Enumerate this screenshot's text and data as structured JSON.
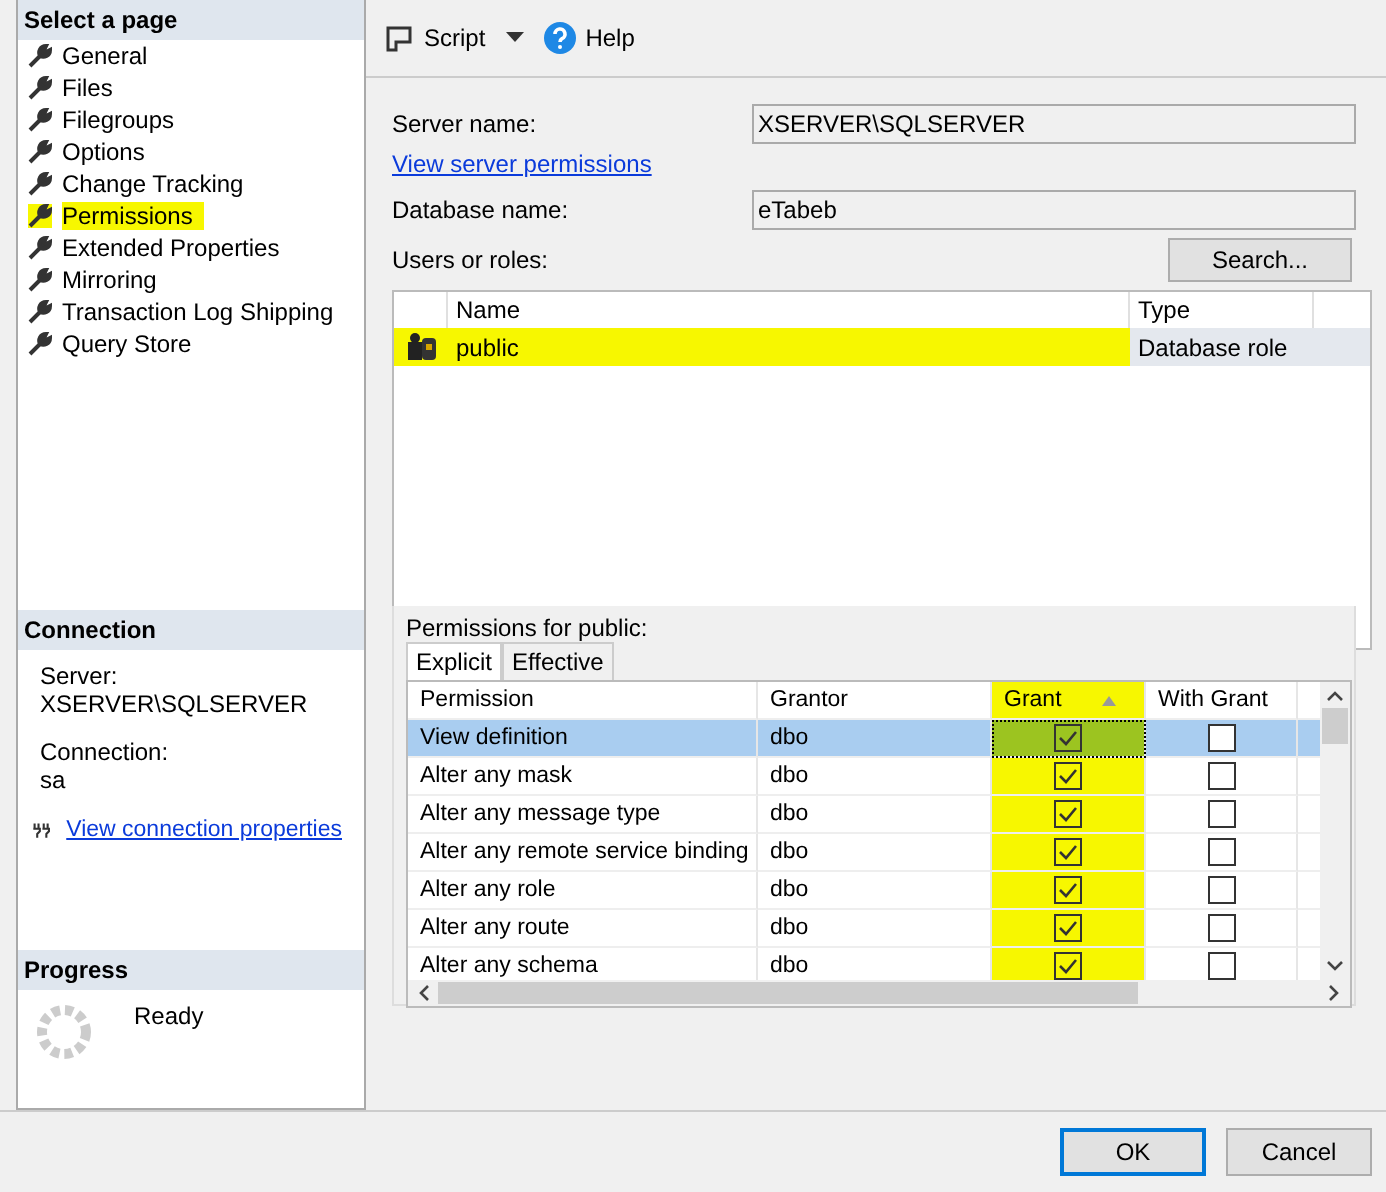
{
  "sidebar": {
    "title": "Select a page",
    "items": [
      {
        "label": "General",
        "selected": false,
        "highlighted": false
      },
      {
        "label": "Files",
        "selected": false,
        "highlighted": false
      },
      {
        "label": "Filegroups",
        "selected": false,
        "highlighted": false
      },
      {
        "label": "Options",
        "selected": false,
        "highlighted": false
      },
      {
        "label": "Change Tracking",
        "selected": false,
        "highlighted": false
      },
      {
        "label": "Permissions",
        "selected": true,
        "highlighted": true
      },
      {
        "label": "Extended Properties",
        "selected": false,
        "highlighted": false
      },
      {
        "label": "Mirroring",
        "selected": false,
        "highlighted": false
      },
      {
        "label": "Transaction Log Shipping",
        "selected": false,
        "highlighted": false
      },
      {
        "label": "Query Store",
        "selected": false,
        "highlighted": false
      }
    ]
  },
  "connection": {
    "title": "Connection",
    "server_label": "Server:",
    "server": "XSERVER\\SQLSERVER",
    "connection_label": "Connection:",
    "connection": "sa",
    "link": "View connection properties"
  },
  "progress": {
    "title": "Progress",
    "status": "Ready"
  },
  "toolbar": {
    "script": "Script",
    "help": "Help"
  },
  "form": {
    "server_label": "Server name:",
    "server": "XSERVER\\SQLSERVER",
    "server_permissions_link": "View server permissions",
    "database_label": "Database name:",
    "database": "eTabeb",
    "users_label": "Users or roles:",
    "search_button": "Search..."
  },
  "users": {
    "columns": [
      "Name",
      "Type"
    ],
    "rows": [
      {
        "name": "public",
        "type": "Database role",
        "selected": true,
        "highlighted": true
      }
    ]
  },
  "permissions": {
    "title": "Permissions for public:",
    "tabs": [
      {
        "label": "Explicit",
        "selected": true
      },
      {
        "label": "Effective",
        "selected": false
      }
    ],
    "columns": [
      {
        "label": "Permission"
      },
      {
        "label": "Grantor"
      },
      {
        "label": "Grant",
        "sorted": true,
        "highlighted": true
      },
      {
        "label": "With Grant"
      }
    ],
    "rows": [
      {
        "permission": "View definition",
        "grantor": "dbo",
        "grant": true,
        "with_grant": false,
        "selected": true
      },
      {
        "permission": "Alter any mask",
        "grantor": "dbo",
        "grant": true,
        "with_grant": false,
        "selected": false
      },
      {
        "permission": "Alter any message type",
        "grantor": "dbo",
        "grant": true,
        "with_grant": false,
        "selected": false
      },
      {
        "permission": "Alter any remote service binding",
        "grantor": "dbo",
        "grant": true,
        "with_grant": false,
        "selected": false
      },
      {
        "permission": "Alter any role",
        "grantor": "dbo",
        "grant": true,
        "with_grant": false,
        "selected": false
      },
      {
        "permission": "Alter any route",
        "grantor": "dbo",
        "grant": true,
        "with_grant": false,
        "selected": false
      },
      {
        "permission": "Alter any schema",
        "grantor": "dbo",
        "grant": true,
        "with_grant": false,
        "selected": false
      }
    ]
  },
  "buttons": [
    {
      "label": "OK",
      "default": true
    },
    {
      "label": "Cancel",
      "default": false
    }
  ]
}
